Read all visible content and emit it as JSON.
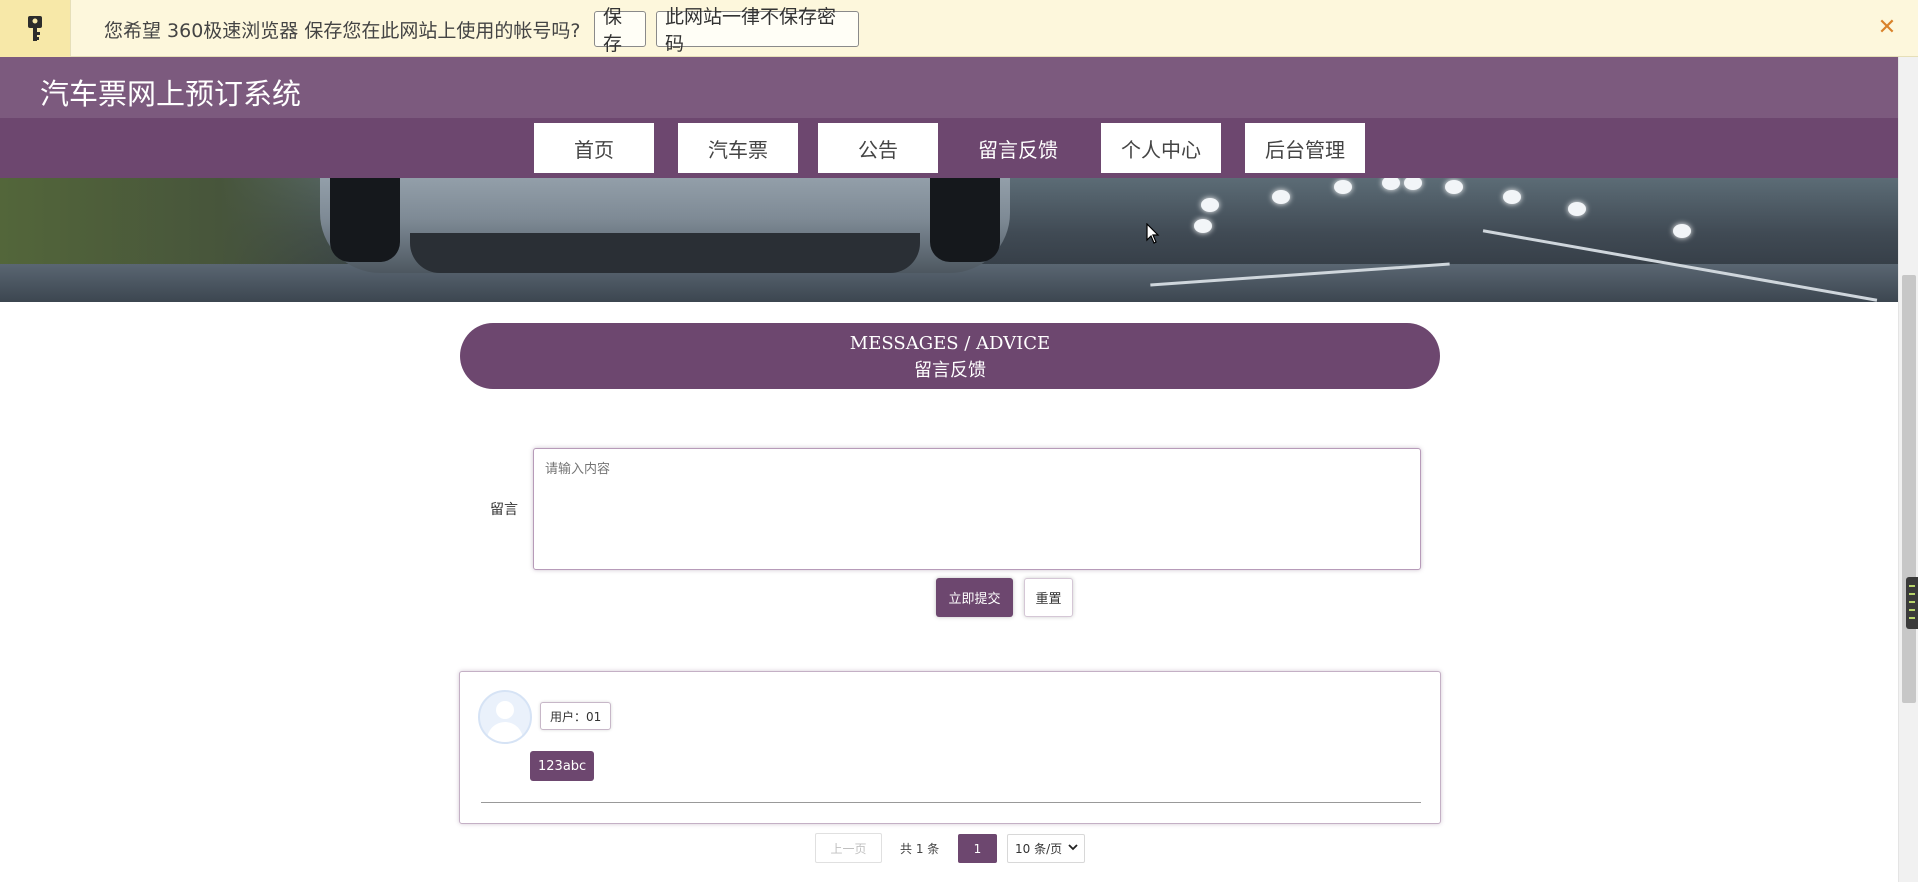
{
  "password_bar": {
    "message": "您希望 360极速浏览器 保存您在此网站上使用的帐号吗?",
    "save_label": "保存",
    "never_label": "此网站一律不保存密码",
    "close_label": "✕",
    "key_icon": "key-icon"
  },
  "header": {
    "title": "汽车票网上预订系统"
  },
  "nav": {
    "items": [
      {
        "label": "首页"
      },
      {
        "label": "汽车票"
      },
      {
        "label": "公告"
      },
      {
        "label": "留言反馈",
        "active": true
      },
      {
        "label": "个人中心"
      },
      {
        "label": "后台管理"
      }
    ]
  },
  "section": {
    "title_en": "MESSAGES / ADVICE",
    "title_zh": "留言反馈"
  },
  "form": {
    "label": "留言",
    "placeholder": "请输入内容",
    "submit_label": "立即提交",
    "reset_label": "重置"
  },
  "messages": [
    {
      "user_label": "用户：01",
      "content": "123abc"
    }
  ],
  "pagination": {
    "prev_label": "上一页",
    "total_label": "共 1 条",
    "current_page": "1",
    "page_size_label": "10 条/页"
  },
  "colors": {
    "theme": "#6d476f",
    "title_bar": "#7c5a7e",
    "password_bar_bg": "#fdf7dc",
    "close_icon": "#d9822b"
  }
}
